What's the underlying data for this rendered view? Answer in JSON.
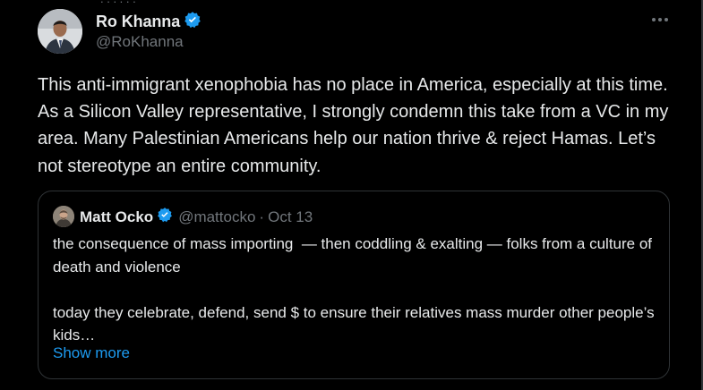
{
  "author": {
    "name": "Ro Khanna",
    "handle": "@RoKhanna",
    "verified": true,
    "verified_color": "#1d9bf0"
  },
  "more_icon": "ellipsis-icon",
  "tweet": {
    "text": "This anti-immigrant xenophobia has no place in America, especially at this time. As a Silicon Valley representative, I strongly condemn this take from a VC in my area. Many Palestinian Americans help our nation thrive & reject Hamas. Let’s not stereotype an entire community."
  },
  "quoted": {
    "name": "Matt Ocko",
    "handle": "@mattocko",
    "separator": "·",
    "date": "Oct 13",
    "verified": true,
    "text": "the consequence of mass importing  — then coddling & exalting — folks from a culture of death and violence\n\ntoday they celebrate, defend, send $ to ensure their relatives mass murder other people’s kids…",
    "show_more": "Show more"
  },
  "colors": {
    "background": "#000000",
    "text": "#e7e9ea",
    "secondary": "#71767b",
    "accent": "#1d9bf0",
    "border": "#2f3336"
  }
}
